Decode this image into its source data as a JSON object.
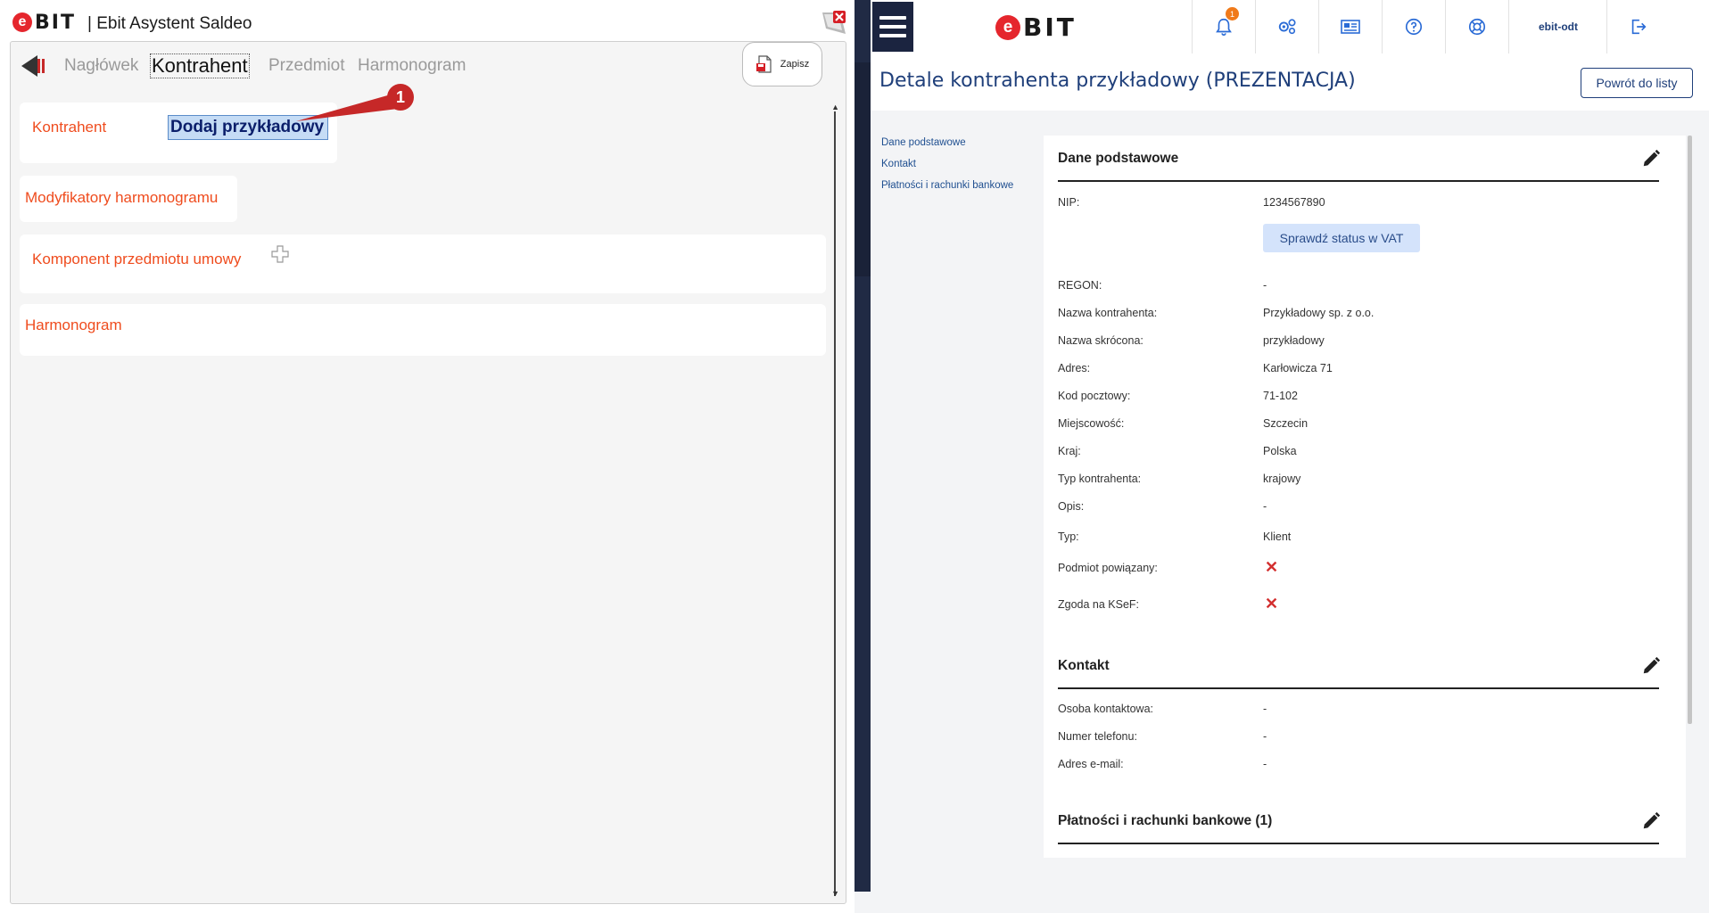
{
  "left_app": {
    "logo": {
      "e": "e",
      "bit": "BIT"
    },
    "title": "| Ebit Asystent Saldeo",
    "tabs": [
      "Nagłówek",
      "Kontrahent",
      "Przedmiot",
      "Harmonogram"
    ],
    "save_label": "Zapisz",
    "kontrahent_label": "Kontrahent",
    "kontrahent_value": "Dodaj przykładowy",
    "callout_number": "1",
    "sections": [
      "Modyfikatory harmonogramu",
      "Komponent przedmiotu umowy",
      "Harmonogram"
    ]
  },
  "right_app": {
    "logo": {
      "e": "e",
      "bit": "BIT"
    },
    "notification_count": "1",
    "user": "ebit-odt",
    "page_title": "Detale kontrahenta przykładowy (PREZENTACJA)",
    "back_button": "Powrót do listy",
    "subnav": [
      "Dane podstawowe",
      "Kontakt",
      "Płatności i rachunki bankowe"
    ],
    "section_basic": {
      "title": "Dane podstawowe",
      "nip_label": "NIP:",
      "nip_value": "1234567890",
      "vat_button": "Sprawdź status w VAT",
      "fields": [
        {
          "label": "REGON:",
          "value": "-"
        },
        {
          "label": "Nazwa kontrahenta:",
          "value": "Przykładowy sp. z o.o."
        },
        {
          "label": "Nazwa skrócona:",
          "value": "przykładowy"
        },
        {
          "label": "Adres:",
          "value": "Karłowicza 71"
        },
        {
          "label": "Kod pocztowy:",
          "value": "71-102"
        },
        {
          "label": "Miejscowość:",
          "value": "Szczecin"
        },
        {
          "label": "Kraj:",
          "value": "Polska"
        },
        {
          "label": "Typ kontrahenta:",
          "value": "krajowy"
        },
        {
          "label": "Opis:",
          "value": "-"
        },
        {
          "label": "Typ:",
          "value": "Klient"
        }
      ],
      "flags": [
        {
          "label": "Podmiot powiązany:",
          "value": "✕"
        },
        {
          "label": "Zgoda na KSeF:",
          "value": "✕"
        }
      ]
    },
    "section_contact": {
      "title": "Kontakt",
      "fields": [
        {
          "label": "Osoba kontaktowa:",
          "value": "-"
        },
        {
          "label": "Numer telefonu:",
          "value": "-"
        },
        {
          "label": "Adres e-mail:",
          "value": "-"
        }
      ]
    },
    "section_payments": {
      "title": "Płatności i rachunki bankowe (1)"
    },
    "colors": {
      "accent": "#1f3f7a",
      "orange": "#ef4c1e",
      "red": "#d32f2f",
      "sidebar": "#202a44"
    }
  }
}
